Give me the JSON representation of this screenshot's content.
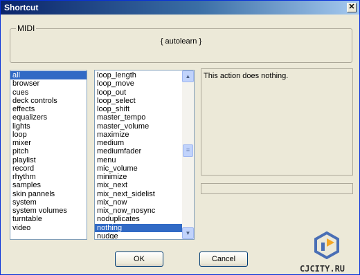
{
  "window": {
    "title": "Shortcut",
    "close_glyph": "✕"
  },
  "midi": {
    "legend": "MIDI",
    "value": "{ autolearn }"
  },
  "categories": [
    "all",
    "browser",
    "cues",
    "deck controls",
    "effects",
    "equalizers",
    "lights",
    "loop",
    "mixer",
    "pitch",
    "playlist",
    "record",
    "rhythm",
    "samples",
    "skin pannels",
    "system",
    "system volumes",
    "turntable",
    "video"
  ],
  "categories_selected": "all",
  "actions": [
    "loop_length",
    "loop_move",
    "loop_out",
    "loop_select",
    "loop_shift",
    "master_tempo",
    "master_volume",
    "maximize",
    "medium",
    "mediumfader",
    "menu",
    "mic_volume",
    "minimize",
    "mix_next",
    "mix_next_sidelist",
    "mix_now",
    "mix_now_nosync",
    "noduplicates",
    "nothing",
    "nudge"
  ],
  "actions_selected": "nothing",
  "description": "This action does nothing.",
  "buttons": {
    "ok": "OK",
    "cancel": "Cancel"
  },
  "watermark": "CJCITY.RU",
  "icons": {
    "scroll_up": "scroll-up-arrow-icon",
    "scroll_down": "scroll-down-arrow-icon",
    "thumb_grip": "scroll-thumb-grip-icon",
    "close": "close-icon",
    "logo": "cjcity-logo-icon"
  },
  "colors": {
    "selection": "#316ac5",
    "titlebar": "#0a246a",
    "logo_orange": "#f5a623",
    "logo_blue": "#4a6fb5"
  }
}
